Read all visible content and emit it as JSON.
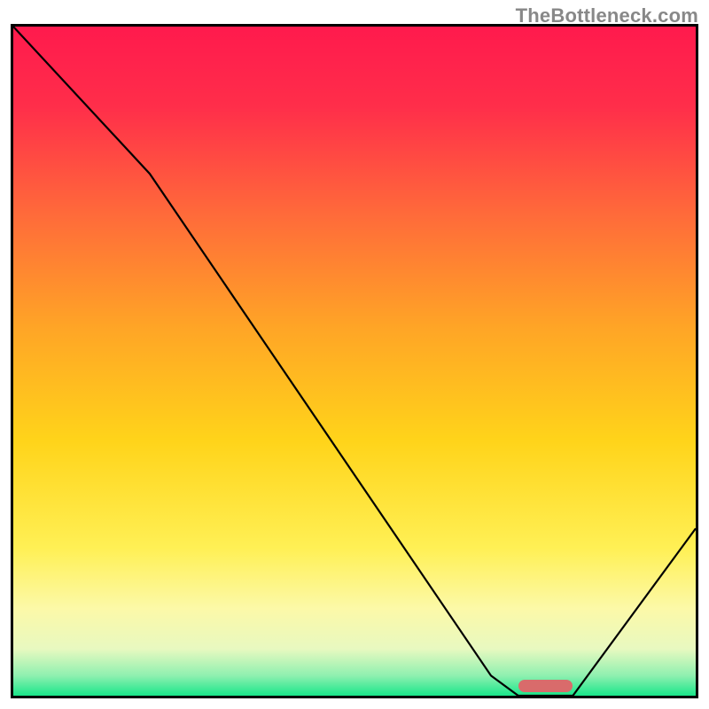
{
  "watermark": {
    "text": "TheBottleneck.com"
  },
  "colors": {
    "gradient_stops": [
      {
        "offset": 0.0,
        "color": "#ff1a4d"
      },
      {
        "offset": 0.12,
        "color": "#ff2e4a"
      },
      {
        "offset": 0.28,
        "color": "#ff6a3a"
      },
      {
        "offset": 0.45,
        "color": "#ffa526"
      },
      {
        "offset": 0.62,
        "color": "#ffd41a"
      },
      {
        "offset": 0.78,
        "color": "#fff055"
      },
      {
        "offset": 0.87,
        "color": "#fcf9a8"
      },
      {
        "offset": 0.93,
        "color": "#e8f9c0"
      },
      {
        "offset": 0.97,
        "color": "#8ff0b0"
      },
      {
        "offset": 1.0,
        "color": "#19e68a"
      }
    ],
    "curve": "#000000",
    "marker": "#d96b6b"
  },
  "chart_data": {
    "type": "line",
    "title": "",
    "xlabel": "",
    "ylabel": "",
    "xlim": [
      0,
      100
    ],
    "ylim": [
      0,
      100
    ],
    "grid": false,
    "x": [
      0,
      20,
      70,
      74,
      82,
      100
    ],
    "series": [
      {
        "name": "curve",
        "values": [
          100,
          78,
          3,
          0,
          0,
          25
        ]
      }
    ],
    "annotations": [
      {
        "type": "marker",
        "x_start": 74,
        "x_end": 82,
        "y": 0
      }
    ]
  }
}
